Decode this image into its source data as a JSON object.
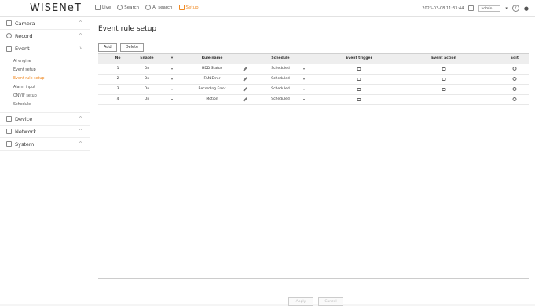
{
  "app": {
    "logo": "WISENeT"
  },
  "topnav": [
    {
      "label": "Live",
      "icon": "monitor-icon"
    },
    {
      "label": "Search",
      "icon": "search-icon"
    },
    {
      "label": "AI search",
      "icon": "ai-search-icon"
    },
    {
      "label": "Setup",
      "icon": "setup-icon",
      "active": true
    }
  ],
  "topright": {
    "datetime": "2023-03-08 11:33:44",
    "user": "admin",
    "help": "?"
  },
  "sidebar": {
    "camera": "Camera",
    "record": "Record",
    "event": "Event",
    "event_items": [
      "AI engine",
      "Event setup",
      "Event rule setup",
      "Alarm input",
      "ONVIF setup",
      "Schedule"
    ],
    "device": "Device",
    "network": "Network",
    "system": "System"
  },
  "page": {
    "title": "Event rule setup",
    "add_label": "Add",
    "delete_label": "Delete"
  },
  "table": {
    "headers": {
      "no": "No",
      "enable": "Enable",
      "rule_name": "Rule name",
      "schedule": "Schedule",
      "event_trigger": "Event trigger",
      "event_action": "Event action",
      "edit": "Edit"
    },
    "rows": [
      {
        "no": "1",
        "enable": "On",
        "rule_name": "HDD Status",
        "schedule": "Scheduled",
        "trigger_icon": "hdd-icon",
        "action_icon": "alarm-icon"
      },
      {
        "no": "2",
        "enable": "On",
        "rule_name": "FAN Error",
        "schedule": "Scheduled",
        "trigger_icon": "fan-icon",
        "action_icon": "alarm-icon"
      },
      {
        "no": "3",
        "enable": "On",
        "rule_name": "Recording Error",
        "schedule": "Scheduled",
        "trigger_icon": "record-error-icon",
        "action_icon": "alarm-icon"
      },
      {
        "no": "4",
        "enable": "On",
        "rule_name": "Motion",
        "schedule": "Scheduled",
        "trigger_icon": "motion-icon",
        "action_icon": ""
      }
    ]
  },
  "footer": {
    "apply": "Apply",
    "cancel": "Cancel"
  }
}
